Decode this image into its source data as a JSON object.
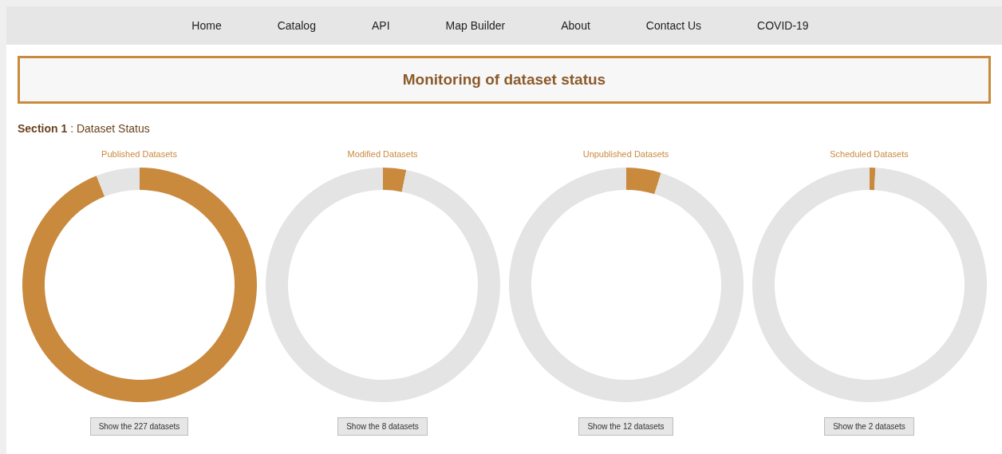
{
  "nav": [
    {
      "label": "Home"
    },
    {
      "label": "Catalog"
    },
    {
      "label": "API"
    },
    {
      "label": "Map Builder"
    },
    {
      "label": "About"
    },
    {
      "label": "Contact Us"
    },
    {
      "label": "COVID-19"
    }
  ],
  "page_title": "Monitoring of dataset status",
  "section": {
    "number": "Section 1",
    "title": " : Dataset Status"
  },
  "gauges": [
    {
      "title": "Published Datasets",
      "chart_data": {
        "type": "donut",
        "values": [
          0.94,
          0.06
        ]
      },
      "button": "Show the 227 datasets"
    },
    {
      "title": "Modified Datasets",
      "chart_data": {
        "type": "donut",
        "values": [
          0.032,
          0.968
        ]
      },
      "button": "Show the 8 datasets"
    },
    {
      "title": "Unpublished Datasets",
      "chart_data": {
        "type": "donut",
        "values": [
          0.048,
          0.952
        ]
      },
      "button": "Show the 12 datasets"
    },
    {
      "title": "Scheduled Datasets",
      "chart_data": {
        "type": "donut",
        "values": [
          0.008,
          0.992
        ]
      },
      "button": "Show the 2 datasets"
    }
  ]
}
